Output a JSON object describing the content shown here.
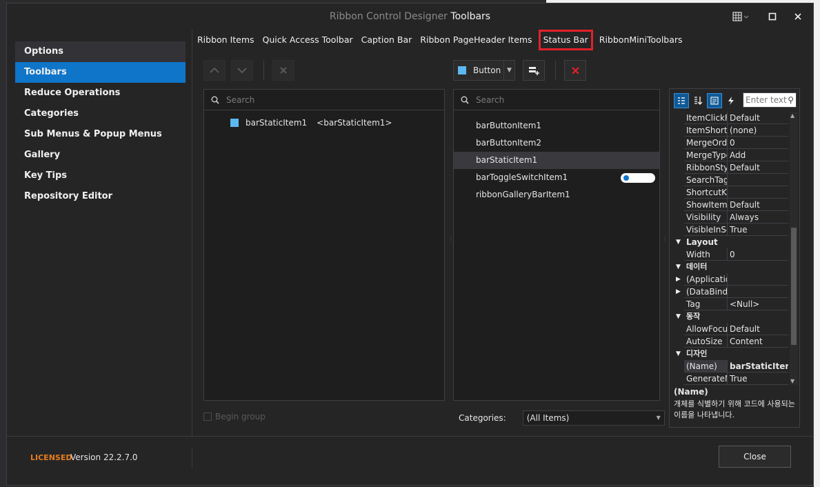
{
  "window": {
    "title_prefix": "Ribbon Control Designer",
    "title_strong": "Toolbars"
  },
  "sidebar": {
    "items": [
      {
        "label": "Options"
      },
      {
        "label": "Toolbars"
      },
      {
        "label": "Reduce Operations"
      },
      {
        "label": "Categories"
      },
      {
        "label": "Sub Menus & Popup Menus"
      },
      {
        "label": "Gallery"
      },
      {
        "label": "Key Tips"
      },
      {
        "label": "Repository Editor"
      }
    ]
  },
  "tabs": [
    {
      "label": "Ribbon Items"
    },
    {
      "label": "Quick Access Toolbar"
    },
    {
      "label": "Caption Bar"
    },
    {
      "label": "Ribbon PageHeader Items"
    },
    {
      "label": "Status Bar"
    },
    {
      "label": "RibbonMiniToolbars"
    }
  ],
  "left_panel": {
    "search_placeholder": "Search",
    "item_name": "barStaticItem1",
    "item_caption": "<barStaticItem1>",
    "begin_group_label": "Begin group"
  },
  "item_type_combo": {
    "value": "Button"
  },
  "right_list": {
    "search_placeholder": "Search",
    "items": [
      {
        "label": "barButtonItem1"
      },
      {
        "label": "barButtonItem2"
      },
      {
        "label": "barStaticItem1"
      },
      {
        "label": "barToggleSwitchItem1"
      },
      {
        "label": "ribbonGalleryBarItem1"
      }
    ],
    "categories_label": "Categories:",
    "categories_value": "(All Items)"
  },
  "properties": {
    "filter_placeholder": "Enter text",
    "rows": [
      {
        "k": "ItemClickFi",
        "v": "Default"
      },
      {
        "k": "ItemShortc",
        "v": "(none)"
      },
      {
        "k": "MergeOrde",
        "v": "0"
      },
      {
        "k": "MergeType",
        "v": "Add"
      },
      {
        "k": "RibbonStyl",
        "v": "Default"
      },
      {
        "k": "SearchTag",
        "v": ""
      },
      {
        "k": "ShortcutKe",
        "v": ""
      },
      {
        "k": "ShowItem",
        "v": "Default"
      },
      {
        "k": "Visibility",
        "v": "Always"
      },
      {
        "k": "VisibleInSe",
        "v": "True"
      },
      {
        "k": "Layout",
        "v": ""
      },
      {
        "k": "Width",
        "v": "0"
      },
      {
        "k": "데이터",
        "v": ""
      },
      {
        "k": "(Applicatio",
        "v": ""
      },
      {
        "k": "(DataBindi",
        "v": ""
      },
      {
        "k": "Tag",
        "v": "<Null>"
      },
      {
        "k": "동작",
        "v": ""
      },
      {
        "k": "AllowFocus",
        "v": "Default"
      },
      {
        "k": "AutoSize",
        "v": "Content"
      },
      {
        "k": "디자인",
        "v": ""
      },
      {
        "k": "(Name)",
        "v": "barStaticItem"
      },
      {
        "k": "GenerateM",
        "v": "True"
      }
    ],
    "desc_title": "(Name)",
    "desc_text": "개체를 식별하기 위해 코드에 사용되는 이름을 나타냅니다."
  },
  "footer": {
    "licensed": "LICENSED",
    "version": "Version 22.2.7.0",
    "close_label": "Close"
  },
  "colors": {
    "accent": "#0f75c9",
    "highlight": "#e3202a",
    "licensed": "#e87d1e"
  }
}
